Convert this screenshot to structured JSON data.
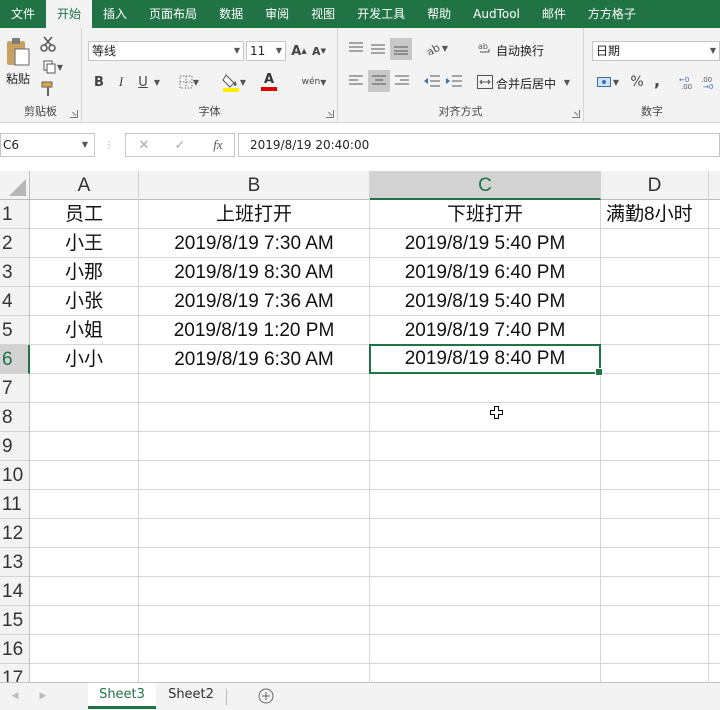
{
  "menu": [
    "文件",
    "开始",
    "插入",
    "页面布局",
    "数据",
    "审阅",
    "视图",
    "开发工具",
    "帮助",
    "AudTool",
    "邮件",
    "方方格子"
  ],
  "ribbon": {
    "clipboard": {
      "label": "剪贴板",
      "paste": "粘贴"
    },
    "font": {
      "label": "字体",
      "name": "等线",
      "size": "11",
      "bold": "B",
      "italic": "I",
      "underline": "U",
      "grow": "A",
      "shrink": "A",
      "font_color_letter": "A",
      "phonetic": "wén"
    },
    "alignment": {
      "label": "对齐方式",
      "wrap": "自动换行",
      "merge": "合并后居中"
    },
    "number": {
      "label": "数字",
      "format": "日期",
      "percent": "%",
      "comma": ","
    }
  },
  "formula_bar": {
    "name_box": "C6",
    "fx": "fx",
    "value": "2019/8/19  20:40:00"
  },
  "columns": [
    "A",
    "B",
    "C",
    "D"
  ],
  "rows": [
    "1",
    "2",
    "3",
    "4",
    "5",
    "6",
    "7",
    "8",
    "9",
    "10",
    "11",
    "12",
    "13",
    "14",
    "15",
    "16",
    "17"
  ],
  "cells": [
    [
      "员工",
      "上班打开",
      "下班打开",
      "满勤8小时"
    ],
    [
      "小王",
      "2019/8/19 7:30 AM",
      "2019/8/19 5:40 PM",
      ""
    ],
    [
      "小那",
      "2019/8/19 8:30 AM",
      "2019/8/19 6:40 PM",
      ""
    ],
    [
      "小张",
      "2019/8/19 7:36 AM",
      "2019/8/19 5:40 PM",
      ""
    ],
    [
      "小姐",
      "2019/8/19 1:20 PM",
      "2019/8/19 7:40 PM",
      ""
    ],
    [
      "小小",
      "2019/8/19 6:30 AM",
      "2019/8/19 8:40 PM",
      ""
    ]
  ],
  "selected": {
    "row": "6",
    "col": "C"
  },
  "sheets": [
    "Sheet3",
    "Sheet2"
  ],
  "active_sheet": "Sheet3",
  "colors": {
    "accent": "#217346",
    "header_bg": "#f3f3f3",
    "selected_header_bg": "#d2d2d2",
    "gridline": "#d4d4d4"
  }
}
